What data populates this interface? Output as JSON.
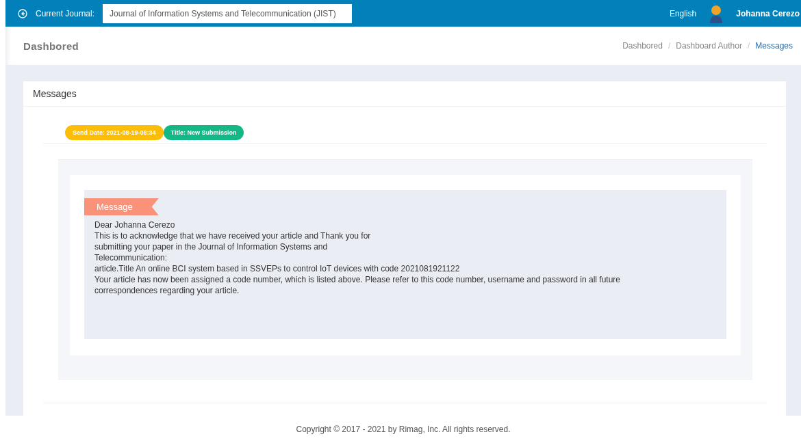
{
  "topbar": {
    "journal_label": "Current Journal:",
    "journal_value": "Journal of Information Systems and Telecommunication (JIST)",
    "language": "English",
    "user": "Johanna Cerezo"
  },
  "header": {
    "title": "Dashbored",
    "breadcrumbs": [
      {
        "label": "Dashbored",
        "selected": false
      },
      {
        "label": "Dashboard Author",
        "selected": false
      },
      {
        "label": "Messages",
        "selected": true
      }
    ],
    "separator": "/"
  },
  "card": {
    "title": "Messages",
    "tags": [
      {
        "text": "Send Date: 2021-08-19-08:34",
        "color": "#fbbd08"
      },
      {
        "text": "Title: New Submission",
        "color": "#14b886"
      }
    ],
    "message": {
      "ribbon": "Message",
      "lines": [
        "Dear Johanna Cerezo",
        "This is to acknowledge that we have received your article and Thank you for",
        "submitting your paper in the Journal of Information Systems and",
        "Telecommunication:",
        "article.Title An online BCI system based in SSVEPs to control IoT devices with code 2021081921122",
        "Your article has now been assigned a code number, which is listed above. Please refer to this code number, username and password in all future correspondences regarding your article."
      ]
    }
  },
  "footer": "Copyright © 2017 - 2021 by Rimag, Inc. All rights reserved."
}
